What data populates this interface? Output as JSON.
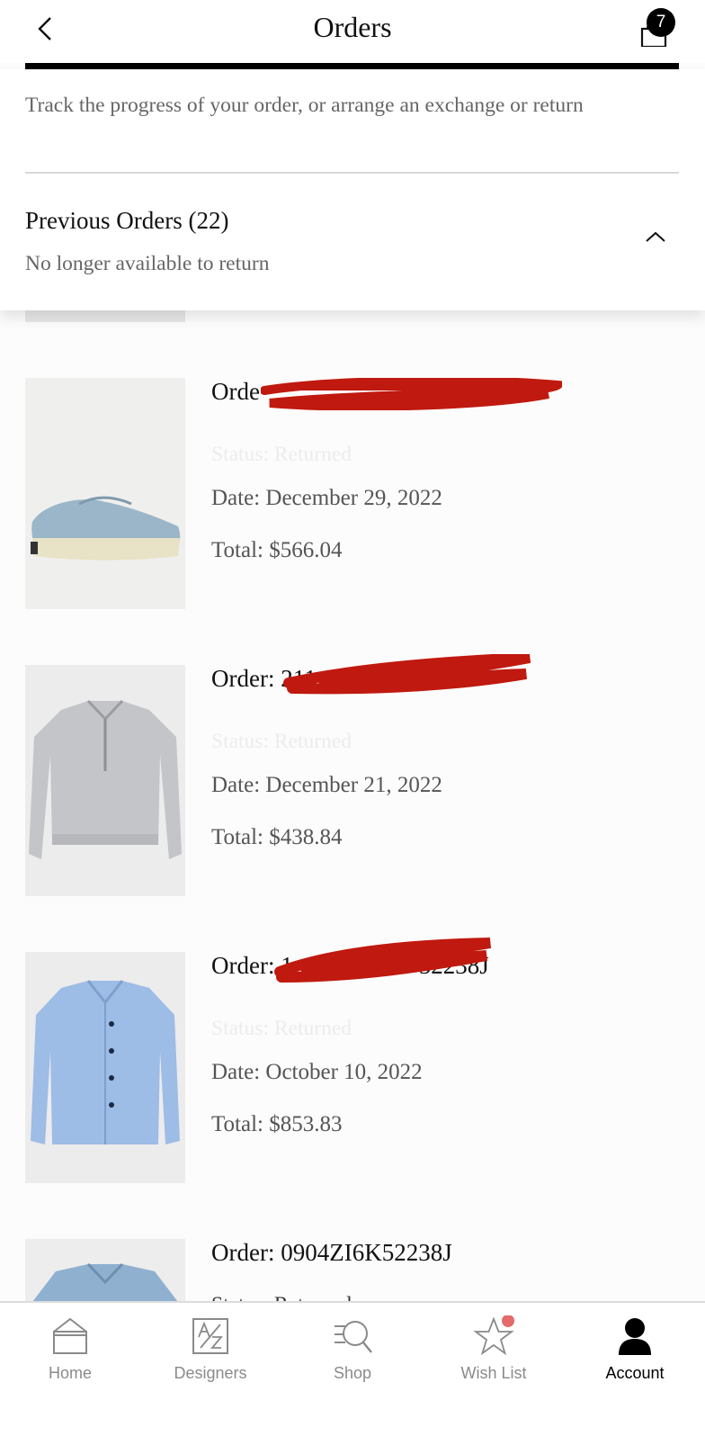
{
  "header": {
    "title": "Orders",
    "bag_count": "7"
  },
  "intro": {
    "text": "Track the progress of your order, or arrange an exchange or return"
  },
  "previous_orders": {
    "title": "Previous Orders (22)",
    "subtitle": "No longer available to return"
  },
  "orders": [
    {
      "order_label": "Orde",
      "status": "Status: Returned",
      "date": "Date: December 29, 2022",
      "total": "Total: $566.04",
      "thumbnail": "light-blue-suede-sneaker"
    },
    {
      "order_label": "Order: 211",
      "status": "Status: Returned",
      "date": "Date: December 21, 2022",
      "total": "Total: $438.84",
      "thumbnail": "grey-half-zip-sweatshirt"
    },
    {
      "order_label": "Order: 1",
      "order_label_tail": "52238J",
      "status": "Status: Returned",
      "date": "Date: October 10, 2022",
      "total": "Total: $853.83",
      "thumbnail": "light-blue-suede-jacket"
    },
    {
      "order_label": "Order: 0904ZI6K52238J",
      "status": "Status: Returned",
      "thumbnail": "denim-jacket"
    }
  ],
  "tabbar": {
    "items": [
      {
        "label": "Home",
        "icon": "home-icon"
      },
      {
        "label": "Designers",
        "icon": "designers-icon"
      },
      {
        "label": "Shop",
        "icon": "shop-search-icon"
      },
      {
        "label": "Wish List",
        "icon": "star-icon"
      },
      {
        "label": "Account",
        "icon": "account-icon"
      }
    ],
    "active": "Account"
  },
  "colors": {
    "accent": "#000000",
    "muted_text": "#666666",
    "redaction": "#c0190f",
    "wishlist_dot": "#e56a6a"
  }
}
